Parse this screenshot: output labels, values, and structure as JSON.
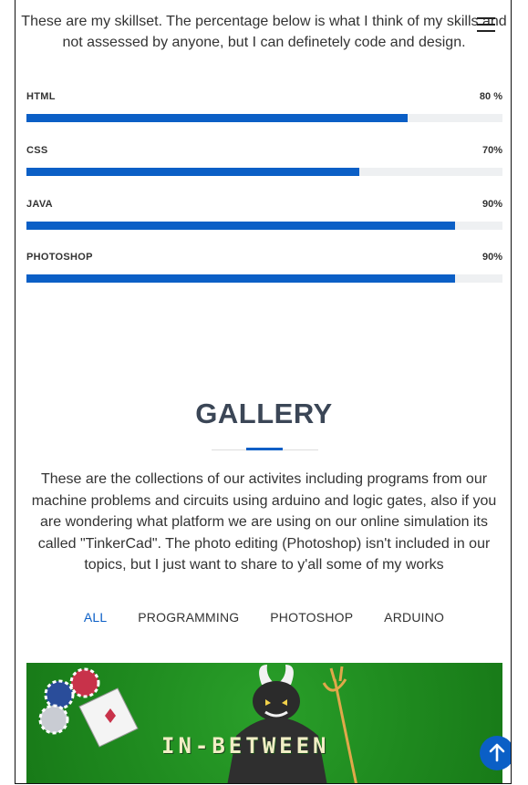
{
  "intro": {
    "text": "These are my skillset. The percentage below is what I think of my skills and not assessed by anyone, but I can definetely code and design."
  },
  "skills": [
    {
      "name": "HTML",
      "value_label": "80 %",
      "percent": 80
    },
    {
      "name": "CSS",
      "value_label": "70%",
      "percent": 70
    },
    {
      "name": "JAVA",
      "value_label": "90%",
      "percent": 90
    },
    {
      "name": "PHOTOSHOP",
      "value_label": "90%",
      "percent": 90
    }
  ],
  "gallery": {
    "title": "GALLERY",
    "description": "These are the collections of our activites including programs from our machine problems and circuits using arduino and logic gates, also if you are wondering what platform we are using on our online simulation its called \"TinkerCad\". The photo editing (Photoshop) isn't included in our topics, but I just want to share to y'all some of my works",
    "filters": [
      "ALL",
      "PROGRAMMING",
      "PHOTOSHOP",
      "ARDUINO"
    ],
    "active_filter": "ALL",
    "image_text": "IN-BETWEEN"
  },
  "icons": {
    "menu": "hamburger-menu-icon",
    "back_to_top": "arrow-up-icon"
  },
  "colors": {
    "accent": "#0b5fc6",
    "track": "#eef0f2",
    "title": "#3b4656",
    "gallery_bg": "#1f8a1f"
  }
}
